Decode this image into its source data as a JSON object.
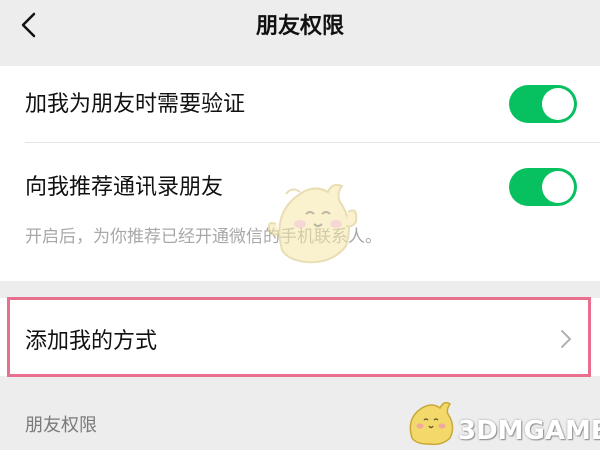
{
  "nav": {
    "title": "朋友权限",
    "back_icon": "chevron-left-icon"
  },
  "settings": {
    "require_verification": {
      "label": "加我为朋友时需要验证",
      "enabled": true
    },
    "recommend_contacts": {
      "label": "向我推荐通讯录朋友",
      "enabled": true,
      "hint": "开启后，为你推荐已经开通微信的手机联系人。"
    },
    "add_methods": {
      "label": "添加我的方式",
      "icon": "chevron-right-icon"
    }
  },
  "section": {
    "label": "朋友权限"
  },
  "colors": {
    "toggle_on": "#07c160",
    "highlight_border": "#e8708e",
    "background": "#ededed"
  },
  "watermark": {
    "text": "3DMGAME"
  }
}
